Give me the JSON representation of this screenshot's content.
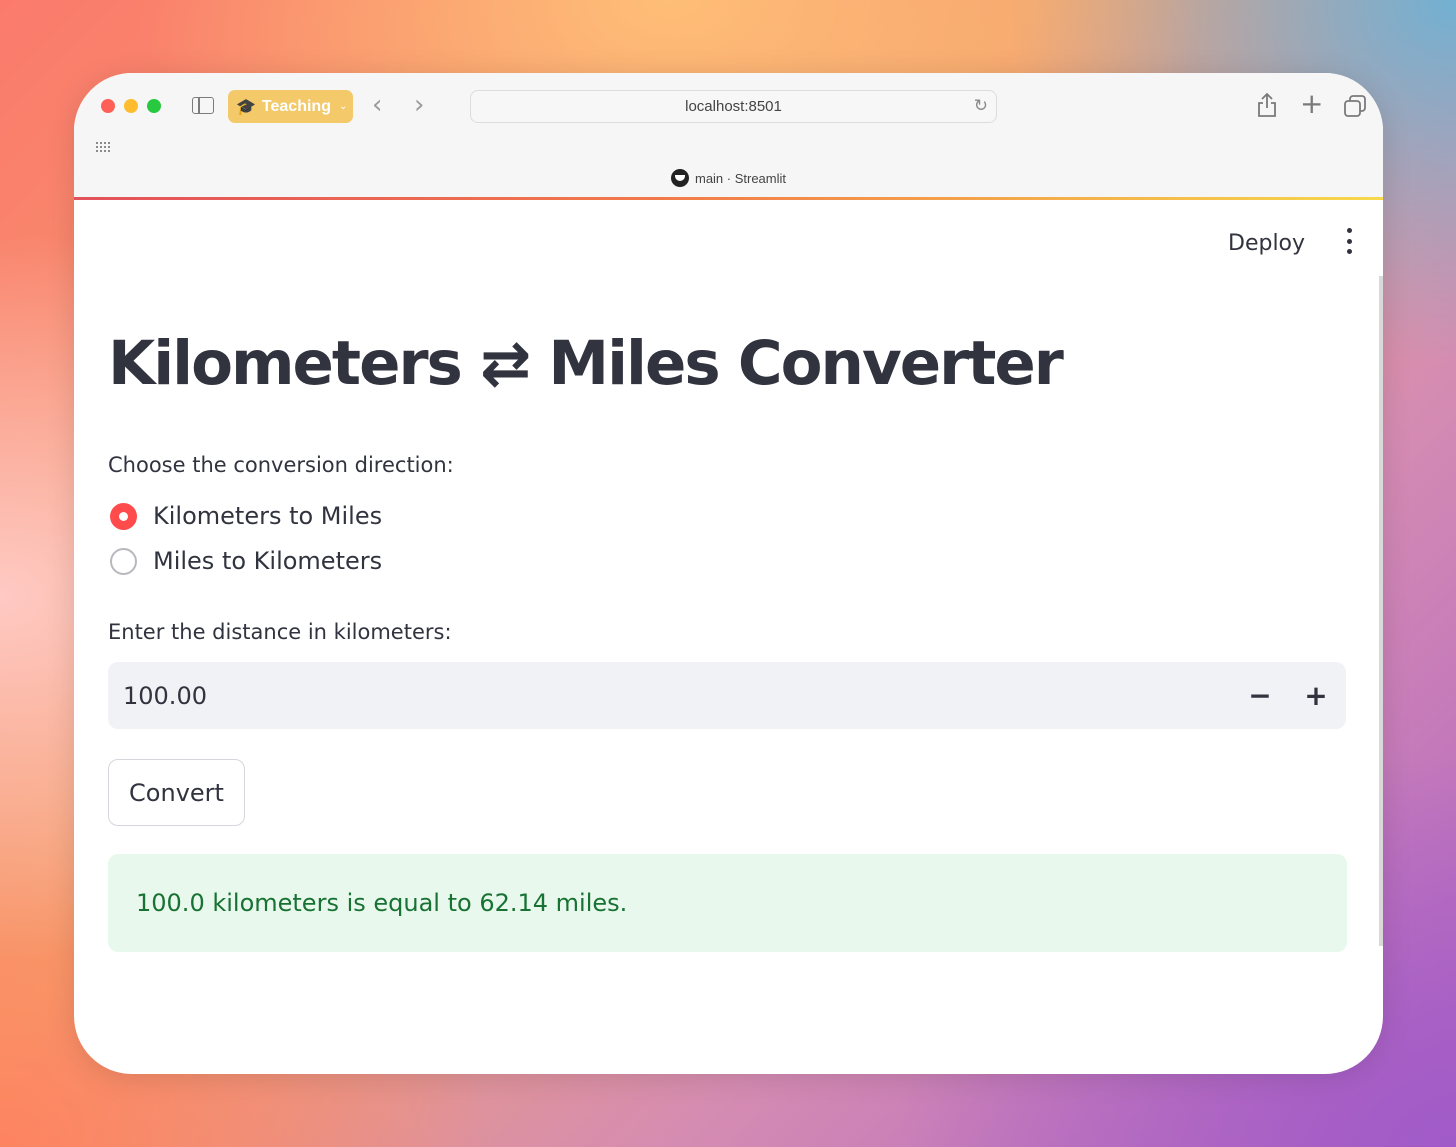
{
  "browser": {
    "profile_label": "Teaching",
    "url": "localhost:8501",
    "tab_title": "main · Streamlit"
  },
  "header": {
    "deploy_label": "Deploy"
  },
  "main": {
    "title": "Kilometers ⇄ Miles Converter",
    "radio": {
      "label": "Choose the conversion direction:",
      "options": [
        "Kilometers to Miles",
        "Miles to Kilometers"
      ],
      "selected": "Kilometers to Miles"
    },
    "number_input": {
      "label": "Enter the distance in kilometers:",
      "value": "100.00",
      "minus": "−",
      "plus": "+"
    },
    "convert_label": "Convert",
    "result": "100.0 kilometers is equal to 62.14 miles."
  },
  "colors": {
    "primary": "#ff4b4b",
    "text": "#31333f",
    "success_bg": "#e9f8ec",
    "success_text": "#177233",
    "profile_pill": "#f3c96a"
  },
  "icons": [
    "sidebar-toggle-icon",
    "graduation-cap-icon",
    "chevron-left-icon",
    "chevron-right-icon",
    "reload-icon",
    "share-icon",
    "plus-icon",
    "tabs-overview-icon",
    "grid-icon",
    "streamlit-favicon",
    "kebab-menu-icon"
  ]
}
